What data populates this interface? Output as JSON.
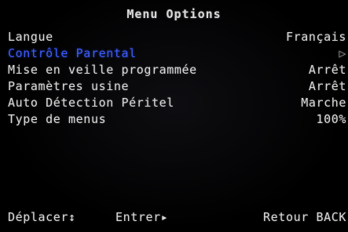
{
  "menu": {
    "title": "Menu Options",
    "items": [
      {
        "label": "Langue",
        "value": "Français"
      },
      {
        "label": "Contrôle Parental",
        "value": "▷"
      },
      {
        "label": "Mise en veille programmée",
        "value": "Arrêt"
      },
      {
        "label": "Paramètres usine",
        "value": "Arrêt"
      },
      {
        "label": "Auto Détection Péritel",
        "value": "Marche"
      },
      {
        "label": "Type de menus",
        "value": "100%"
      }
    ],
    "selected_index": 1
  },
  "footer": {
    "move_hint": "Déplacer↕",
    "enter_hint": "Entrer▸",
    "back_hint": "Retour BACK"
  },
  "colors": {
    "background": "#000000",
    "text": "#d9d9d9",
    "highlight": "#3b5cff"
  }
}
